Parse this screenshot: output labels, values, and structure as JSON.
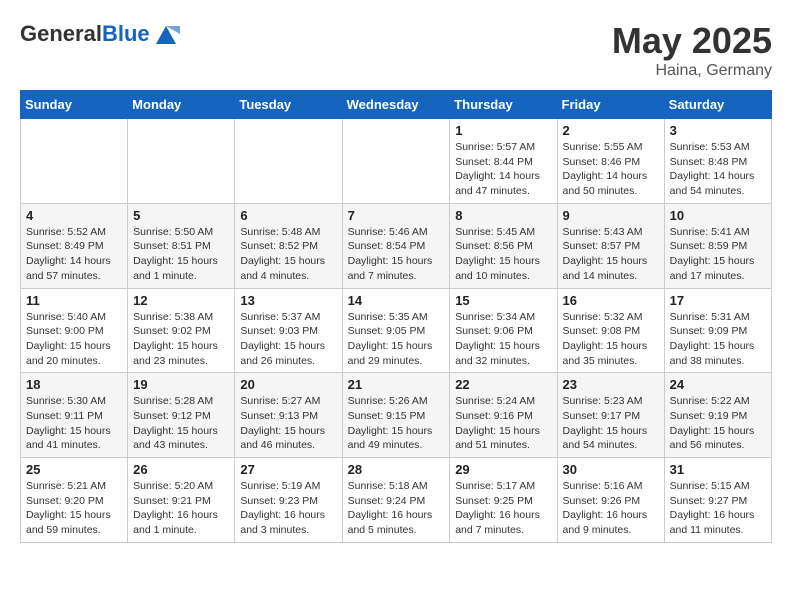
{
  "header": {
    "logo_general": "General",
    "logo_blue": "Blue",
    "month": "May 2025",
    "location": "Haina, Germany"
  },
  "weekdays": [
    "Sunday",
    "Monday",
    "Tuesday",
    "Wednesday",
    "Thursday",
    "Friday",
    "Saturday"
  ],
  "weeks": [
    [
      {
        "day": "",
        "detail": ""
      },
      {
        "day": "",
        "detail": ""
      },
      {
        "day": "",
        "detail": ""
      },
      {
        "day": "",
        "detail": ""
      },
      {
        "day": "1",
        "detail": "Sunrise: 5:57 AM\nSunset: 8:44 PM\nDaylight: 14 hours\nand 47 minutes."
      },
      {
        "day": "2",
        "detail": "Sunrise: 5:55 AM\nSunset: 8:46 PM\nDaylight: 14 hours\nand 50 minutes."
      },
      {
        "day": "3",
        "detail": "Sunrise: 5:53 AM\nSunset: 8:48 PM\nDaylight: 14 hours\nand 54 minutes."
      }
    ],
    [
      {
        "day": "4",
        "detail": "Sunrise: 5:52 AM\nSunset: 8:49 PM\nDaylight: 14 hours\nand 57 minutes."
      },
      {
        "day": "5",
        "detail": "Sunrise: 5:50 AM\nSunset: 8:51 PM\nDaylight: 15 hours\nand 1 minute."
      },
      {
        "day": "6",
        "detail": "Sunrise: 5:48 AM\nSunset: 8:52 PM\nDaylight: 15 hours\nand 4 minutes."
      },
      {
        "day": "7",
        "detail": "Sunrise: 5:46 AM\nSunset: 8:54 PM\nDaylight: 15 hours\nand 7 minutes."
      },
      {
        "day": "8",
        "detail": "Sunrise: 5:45 AM\nSunset: 8:56 PM\nDaylight: 15 hours\nand 10 minutes."
      },
      {
        "day": "9",
        "detail": "Sunrise: 5:43 AM\nSunset: 8:57 PM\nDaylight: 15 hours\nand 14 minutes."
      },
      {
        "day": "10",
        "detail": "Sunrise: 5:41 AM\nSunset: 8:59 PM\nDaylight: 15 hours\nand 17 minutes."
      }
    ],
    [
      {
        "day": "11",
        "detail": "Sunrise: 5:40 AM\nSunset: 9:00 PM\nDaylight: 15 hours\nand 20 minutes."
      },
      {
        "day": "12",
        "detail": "Sunrise: 5:38 AM\nSunset: 9:02 PM\nDaylight: 15 hours\nand 23 minutes."
      },
      {
        "day": "13",
        "detail": "Sunrise: 5:37 AM\nSunset: 9:03 PM\nDaylight: 15 hours\nand 26 minutes."
      },
      {
        "day": "14",
        "detail": "Sunrise: 5:35 AM\nSunset: 9:05 PM\nDaylight: 15 hours\nand 29 minutes."
      },
      {
        "day": "15",
        "detail": "Sunrise: 5:34 AM\nSunset: 9:06 PM\nDaylight: 15 hours\nand 32 minutes."
      },
      {
        "day": "16",
        "detail": "Sunrise: 5:32 AM\nSunset: 9:08 PM\nDaylight: 15 hours\nand 35 minutes."
      },
      {
        "day": "17",
        "detail": "Sunrise: 5:31 AM\nSunset: 9:09 PM\nDaylight: 15 hours\nand 38 minutes."
      }
    ],
    [
      {
        "day": "18",
        "detail": "Sunrise: 5:30 AM\nSunset: 9:11 PM\nDaylight: 15 hours\nand 41 minutes."
      },
      {
        "day": "19",
        "detail": "Sunrise: 5:28 AM\nSunset: 9:12 PM\nDaylight: 15 hours\nand 43 minutes."
      },
      {
        "day": "20",
        "detail": "Sunrise: 5:27 AM\nSunset: 9:13 PM\nDaylight: 15 hours\nand 46 minutes."
      },
      {
        "day": "21",
        "detail": "Sunrise: 5:26 AM\nSunset: 9:15 PM\nDaylight: 15 hours\nand 49 minutes."
      },
      {
        "day": "22",
        "detail": "Sunrise: 5:24 AM\nSunset: 9:16 PM\nDaylight: 15 hours\nand 51 minutes."
      },
      {
        "day": "23",
        "detail": "Sunrise: 5:23 AM\nSunset: 9:17 PM\nDaylight: 15 hours\nand 54 minutes."
      },
      {
        "day": "24",
        "detail": "Sunrise: 5:22 AM\nSunset: 9:19 PM\nDaylight: 15 hours\nand 56 minutes."
      }
    ],
    [
      {
        "day": "25",
        "detail": "Sunrise: 5:21 AM\nSunset: 9:20 PM\nDaylight: 15 hours\nand 59 minutes."
      },
      {
        "day": "26",
        "detail": "Sunrise: 5:20 AM\nSunset: 9:21 PM\nDaylight: 16 hours\nand 1 minute."
      },
      {
        "day": "27",
        "detail": "Sunrise: 5:19 AM\nSunset: 9:23 PM\nDaylight: 16 hours\nand 3 minutes."
      },
      {
        "day": "28",
        "detail": "Sunrise: 5:18 AM\nSunset: 9:24 PM\nDaylight: 16 hours\nand 5 minutes."
      },
      {
        "day": "29",
        "detail": "Sunrise: 5:17 AM\nSunset: 9:25 PM\nDaylight: 16 hours\nand 7 minutes."
      },
      {
        "day": "30",
        "detail": "Sunrise: 5:16 AM\nSunset: 9:26 PM\nDaylight: 16 hours\nand 9 minutes."
      },
      {
        "day": "31",
        "detail": "Sunrise: 5:15 AM\nSunset: 9:27 PM\nDaylight: 16 hours\nand 11 minutes."
      }
    ]
  ]
}
